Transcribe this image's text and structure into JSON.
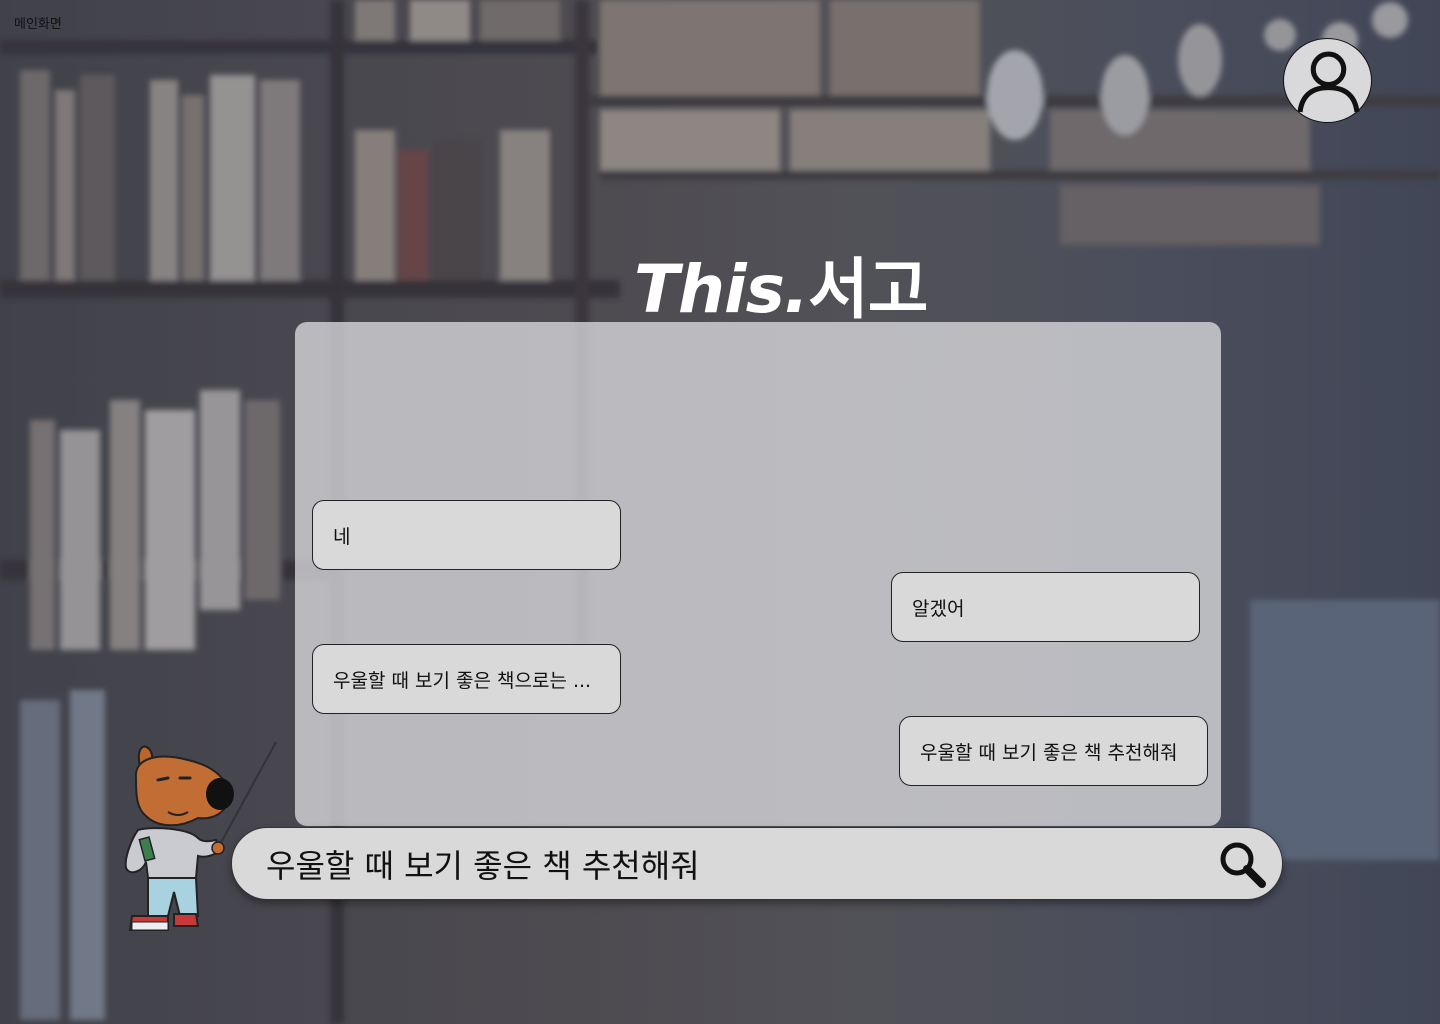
{
  "page": {
    "label": "메인화면"
  },
  "brand": {
    "latin": "This.",
    "korean": "서고"
  },
  "chat": {
    "messages": [
      {
        "side": "bot",
        "text": "네"
      },
      {
        "side": "user",
        "text": "알겠어"
      },
      {
        "side": "bot",
        "text": "우울할 때 보기 좋은 책으로는 ..."
      },
      {
        "side": "user",
        "text": "우울할 때 보기 좋은 책 추천해줘"
      }
    ]
  },
  "search": {
    "value": "우울할 때 보기 좋은 책 추천해줘",
    "icon": "search-icon"
  },
  "profile": {
    "icon": "user-icon"
  },
  "colors": {
    "panel": "#d9d9da",
    "brand_text": "#ffffff",
    "border": "#222222"
  }
}
